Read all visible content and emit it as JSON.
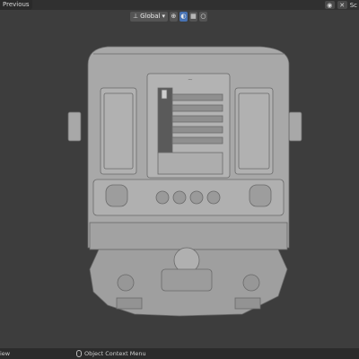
{
  "top_bar": {
    "left_label": "Previous",
    "right_label": "Sc",
    "icons": [
      "camera-icon",
      "close-icon"
    ]
  },
  "header": {
    "orientation_label": "Global",
    "orientation_icon": "axes-icon",
    "pivot_icon": "pivot-icon",
    "snap_icon": "magnet-icon",
    "snap_grid_icon": "grid-icon",
    "proportional_icon": "proportional-edit-icon"
  },
  "model": {
    "subject": "metro train car rear view",
    "base_color": "#a9a9a9"
  },
  "status_bar": {
    "left_text": "iew",
    "context_text": "Object Context Menu"
  },
  "colors": {
    "viewport_bg": "#3d3d3d",
    "header_bg": "#303030",
    "accent": "#4772b3",
    "status_bg": "#2b2b2b"
  }
}
